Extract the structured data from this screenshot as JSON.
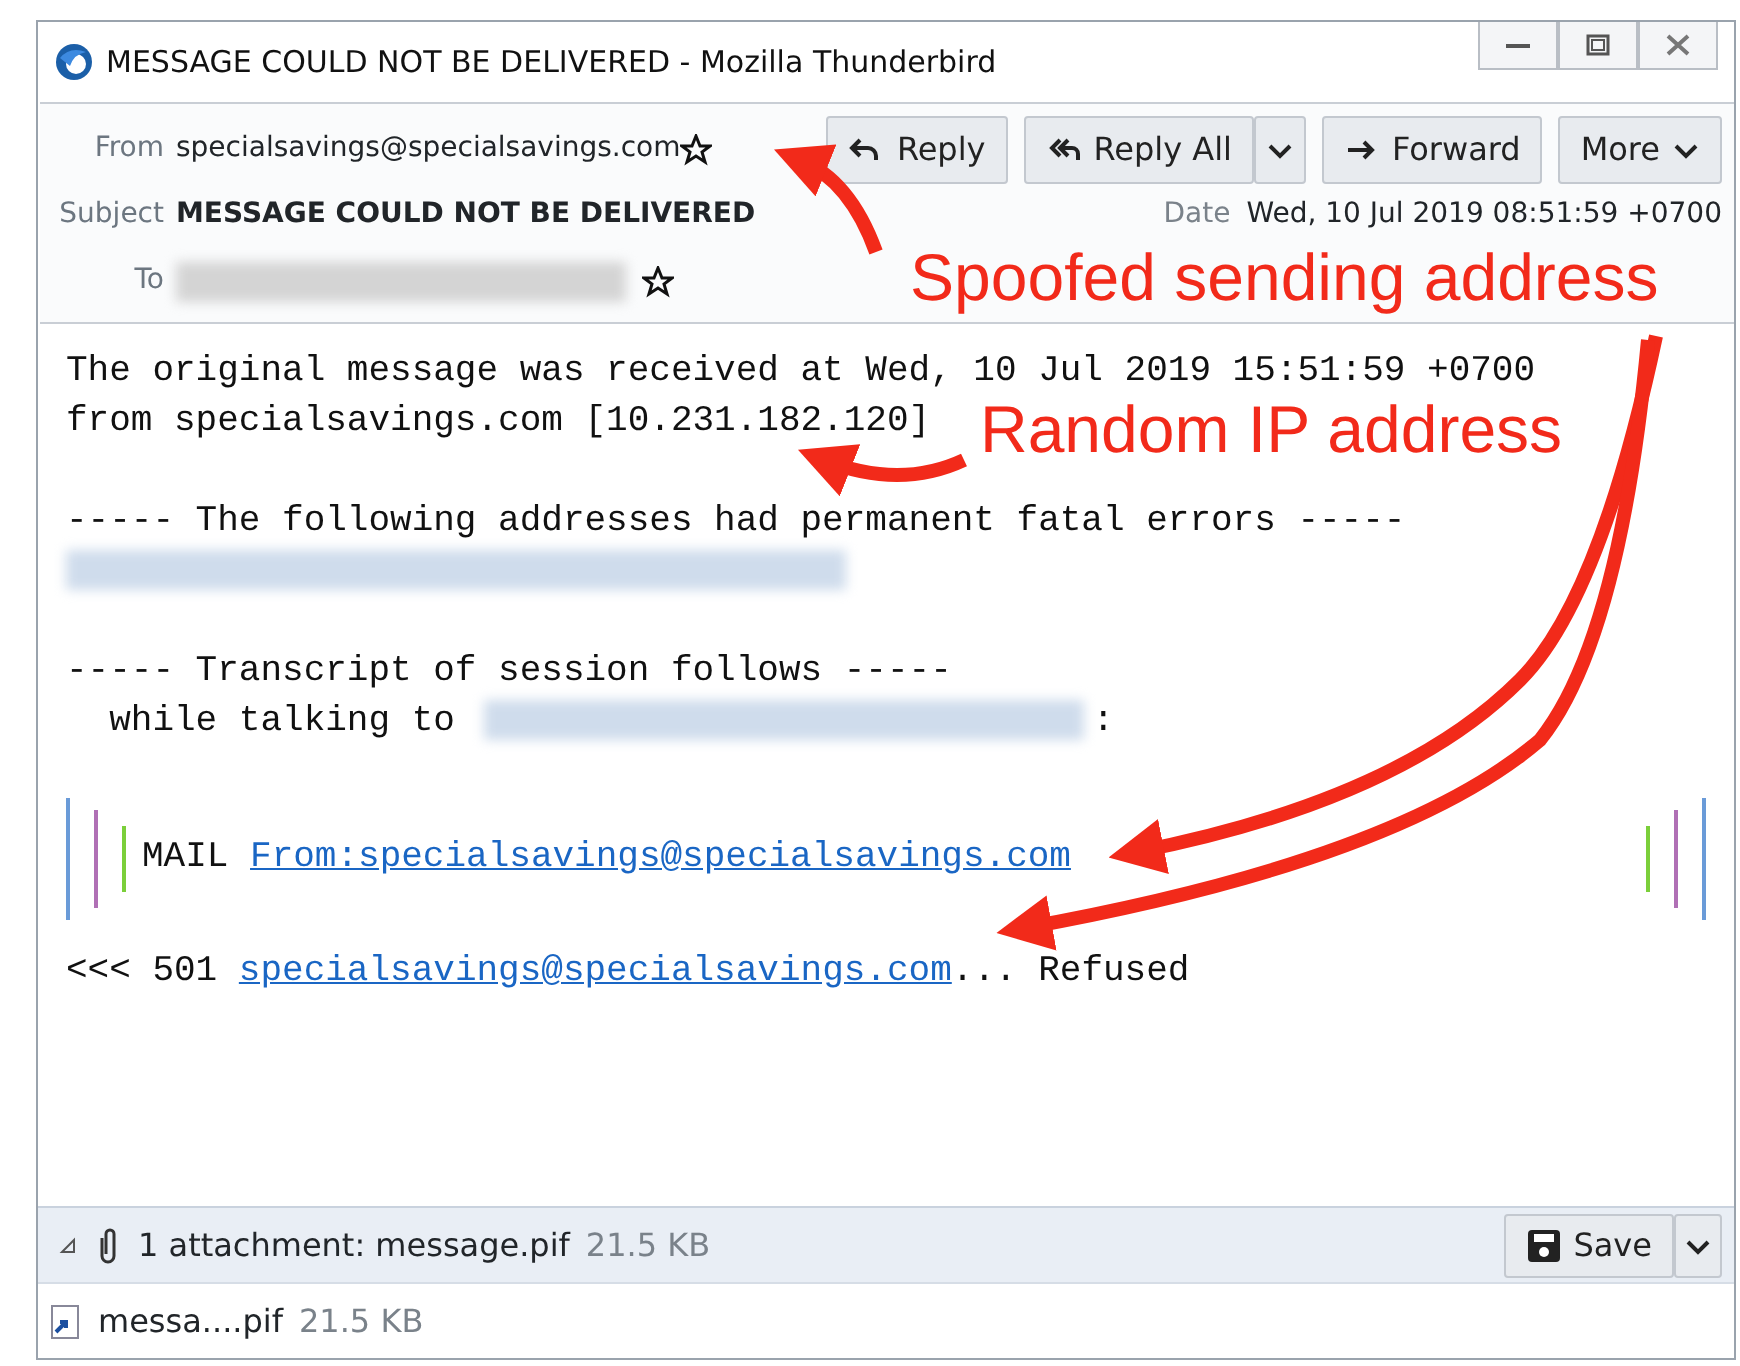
{
  "window": {
    "title": "MESSAGE COULD NOT BE DELIVERED - Mozilla Thunderbird"
  },
  "header": {
    "from_label": "From",
    "from": "specialsavings@specialsavings.com",
    "subject_label": "Subject",
    "subject": "MESSAGE COULD NOT BE DELIVERED",
    "date_label": "Date",
    "date": "Wed, 10 Jul 2019 08:51:59 +0700",
    "to_label": "To"
  },
  "toolbar": [
    {
      "kind": "reply",
      "label": "Reply",
      "menu": false
    },
    {
      "kind": "reply-all",
      "label": "Reply All",
      "menu": true
    },
    {
      "kind": "forward",
      "label": "Forward",
      "menu": false
    },
    {
      "kind": "more",
      "label": "More",
      "menu": false
    }
  ],
  "body": [
    {
      "quoted": false,
      "lines": [
        {
          "kind": "text",
          "text": "The original message was received at Wed, 10 Jul 2019 15:51:59 +0700"
        },
        {
          "kind": "text",
          "text": "from specialsavings.com [10.231.182.120]"
        }
      ]
    },
    {
      "quoted": false,
      "lines": [
        {
          "kind": "text",
          "text": "----- The following addresses had permanent fatal errors -----"
        },
        {
          "kind": "redacted"
        }
      ]
    },
    {
      "quoted": false,
      "lines": [
        {
          "kind": "text",
          "text": "----- Transcript of session follows -----"
        },
        {
          "kind": "redacted_inline",
          "before": "  while talking to ",
          "after": ":"
        }
      ]
    },
    {
      "quoted": true,
      "lines": [
        {
          "kind": "link",
          "before": "MAIL ",
          "link": "From:specialsavings@specialsavings.com"
        }
      ]
    },
    {
      "quoted": false,
      "lines": [
        {
          "kind": "link",
          "before": "<<< 501 ",
          "link": "specialsavings@specialsavings.com",
          "after": "... Refused"
        }
      ]
    }
  ],
  "attachment_bar": {
    "summary": "1 attachment: message.pif",
    "size": "21.5 KB",
    "save": "Save"
  },
  "attachments": [
    {
      "name": "messa....pif",
      "size": "21.5 KB"
    }
  ],
  "annotations": [
    {
      "text": "Spoofed sending address"
    },
    {
      "text": "Random IP address"
    }
  ]
}
